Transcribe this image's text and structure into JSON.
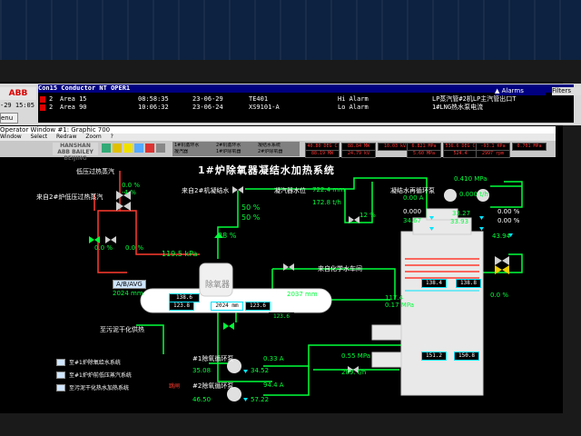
{
  "alarm_bar": {
    "logo": "ABB",
    "time": "-29 15:05",
    "menu": "enu",
    "header": "Con15  Conductor NT   OPER1",
    "alarms_button": "Alarms",
    "filters_button": "Filters",
    "rows": [
      {
        "pri": "2",
        "area": "Area 15",
        "time": "08:58:35",
        "date": "23-06-29",
        "tag": "TE401",
        "state": "Hi Alarm",
        "desc": "LP蒸汽管#2机LP主汽管出口T"
      },
      {
        "pri": "2",
        "area": "Area 90",
        "time": "10:06:32",
        "date": "23-06-24",
        "tag": "XS9101-A",
        "state": "Lo Alarm",
        "desc": "1#LNG热水泵电流"
      }
    ]
  },
  "window": {
    "title": "Operator Window #1: Graphic 700",
    "menu": [
      "Window",
      "Select",
      "Redraw",
      "Zoom",
      "?"
    ],
    "brand_line1": "HANSHAN",
    "brand_line2": "ABB BAILEY BEIJING",
    "tabs": [
      "1#机循环水",
      "2#机循环水",
      "凝结水系统",
      "凝汽器",
      "1#炉除氧器",
      "2#炉除氧器"
    ],
    "toolbar_values": [
      "40.80 DEG C",
      "88.84 MW",
      "10.03 kV",
      "6.821 MPa",
      "536.6 DEG C",
      "-93.1 KPa",
      "0.701 MPa",
      "88.19 MW",
      "24.79 kV",
      "5.60 MPa",
      "524.4",
      "2997 rpm"
    ]
  },
  "graphic": {
    "title": "1#炉除氧器凝结水加热系统",
    "labels": {
      "lp_desuper": "低压过热蒸汽",
      "from_boiler2": "来自2#炉低压过热蒸汽",
      "from_condensate": "来自2#机凝结水",
      "deaerator_tank_label": "除氧器",
      "from_chem": "来自化学水车间",
      "hw_pump": "凝结水再循环泵",
      "to_dryer": "至污泥干化供热",
      "pump1": "#1除氧循环泵",
      "pump2": "#2除氧循环泵",
      "avg_box": "A/B/AVG",
      "trip_label": "跳闸",
      "cond_level": "凝汽器水位"
    },
    "values": {
      "v1": "0.0 %",
      "v2": "-4 %",
      "v3": "0.0 %",
      "v4": "0.0 %",
      "cond_level": "722.4 mm",
      "flow1": "172.8 t/h",
      "open50a": "50 %",
      "open50b": "50 %",
      "valve12": "12 %",
      "pressure_deaer": "119.5 kPa",
      "open28": "28 %",
      "hw_current": "0.00 A",
      "hw_press": "0.410 MPa",
      "hw_flow": "0.000 t/h",
      "hw_a": "0.000",
      "hw_b": "33.27",
      "hw_c": "0.00 %",
      "hw_d": "34.67",
      "hw_e": "33.93",
      "hw_f": "0.00 %",
      "hw_g": "43.94",
      "level_avg": "2024 mm",
      "level2": "2024 mm",
      "level3": "2037 mm",
      "box1": "138.6 kPa",
      "box2": "123.8",
      "box3": "123.6",
      "box4": "123.6",
      "stack1": "117.4",
      "stack2": "0.17 MPa",
      "box5": "138.4",
      "box6": "138.8",
      "pct0": "0.0 %",
      "p1_current": "0.33 A",
      "p1_a": "35.08",
      "p1_b": "34.52",
      "p2_current": "94.4 A",
      "p2_a": "46.50",
      "p2_b": "57.22",
      "press2": "0.55 MPa",
      "flow2": "289. t/h",
      "box7": "151.2",
      "box8": "150.8"
    },
    "legend": [
      "至#1炉除氧给水系统",
      "至#1炉炉前低压蒸汽系统",
      "至污泥干化热水加热系统"
    ]
  },
  "colors": {
    "steam": "#ff3b2f",
    "water": "#00ff3a",
    "cyan": "#00e5ff"
  }
}
